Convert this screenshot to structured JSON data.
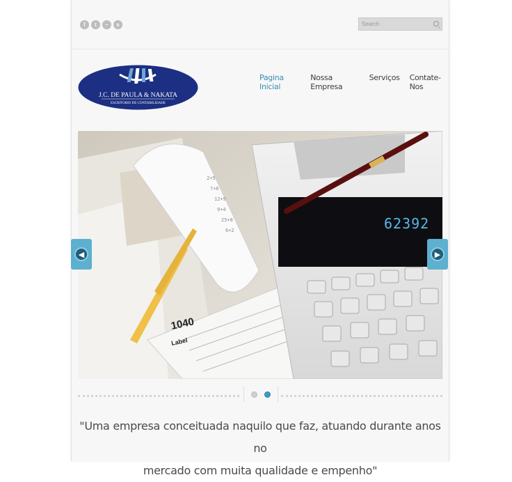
{
  "header": {
    "social_icons": [
      "facebook-icon",
      "twitter-icon",
      "rss-icon",
      "skype-icon"
    ],
    "search_placeholder": "Search"
  },
  "logo": {
    "line1": "J.C. DE PAULA & NAKATA",
    "line2": "ESCRITORIO DE CONTABILIDADE"
  },
  "nav": {
    "items": [
      "Pagina Inicial",
      "Nossa Empresa",
      "Serviços",
      "Contate-Nos"
    ],
    "active_index": 0
  },
  "slider": {
    "calculator_display": "62392",
    "form_number": "1040",
    "form_label": "Label",
    "slide_count": 2,
    "active_slide": 2
  },
  "quote": {
    "line1": "\"Uma empresa conceituada naquilo que faz, atuando durante anos no",
    "line2": "mercado com muita qualidade e empenho\""
  },
  "colors": {
    "accent": "#3b8bb3",
    "logo_navy": "#1c2f82",
    "arrow": "#5db0cf"
  }
}
